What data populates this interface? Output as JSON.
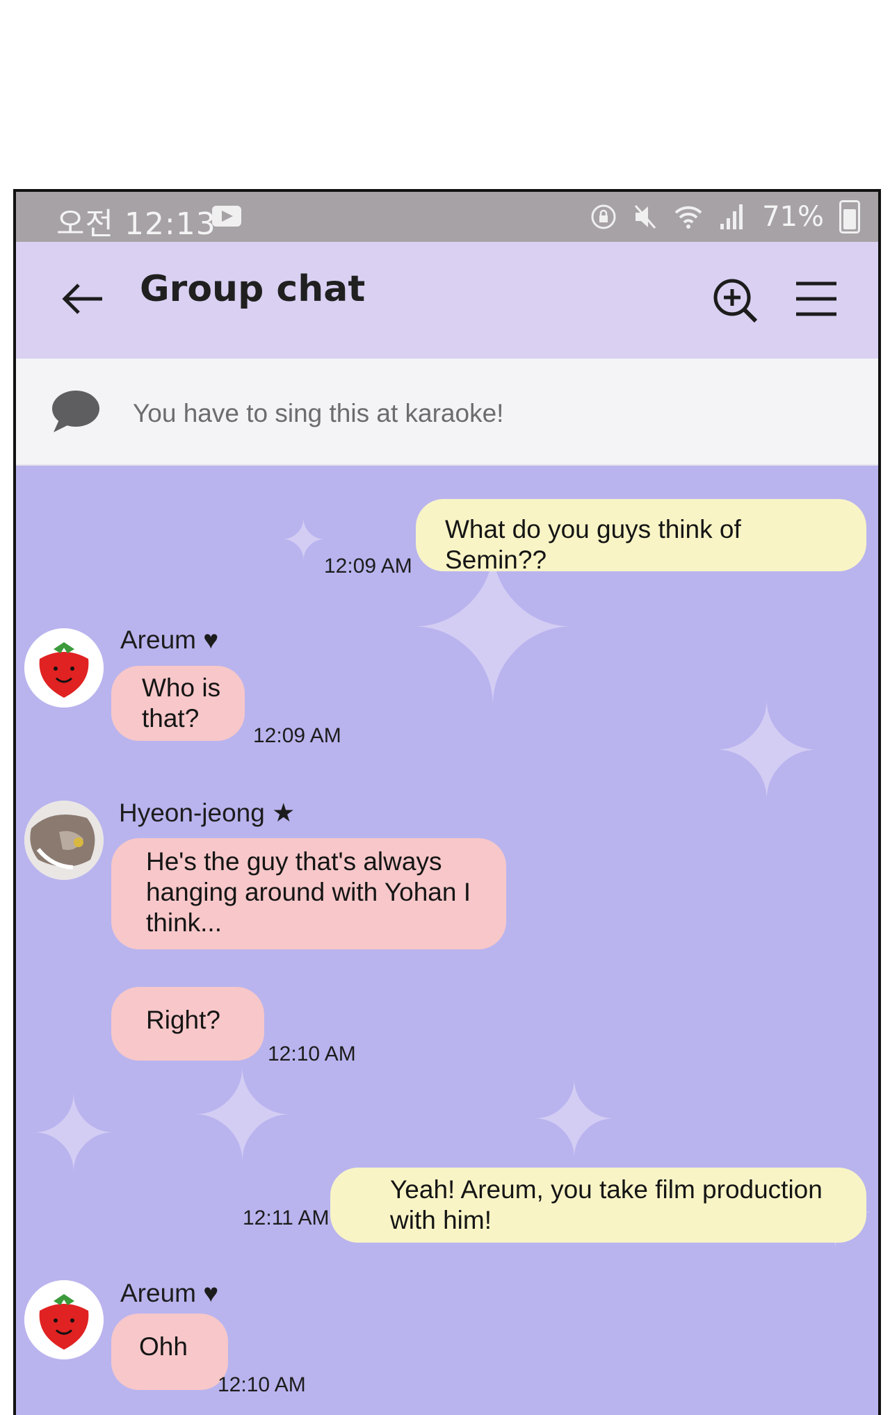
{
  "status_bar": {
    "time": "오전 12:13",
    "battery": "71%"
  },
  "header": {
    "title": "Group chat"
  },
  "notice": {
    "text": "You have to sing this at karaoke!"
  },
  "messages": [
    {
      "sender": "",
      "text": "What do you guys think of Semin??",
      "time": "12:09 AM"
    },
    {
      "sender": "Areum ♥",
      "text": "Who is that?",
      "time": "12:09 AM"
    },
    {
      "sender": "Hyeon-jeong ★",
      "text": "He's the guy that's always hanging around with Yohan I think...",
      "time": ""
    },
    {
      "sender": "",
      "text": "Right?",
      "time": "12:10 AM"
    },
    {
      "sender": "",
      "text": "Yeah! Areum, you take film production with him!",
      "time": "12:11 AM"
    },
    {
      "sender": "Areum ♥",
      "text": "Ohh",
      "time": "12:10 AM"
    }
  ],
  "colors": {
    "background": "#b9b4ee",
    "header": "#d9d0f2",
    "my_bubble": "#f8f4c6",
    "their_bubble": "#f7c7c9",
    "status_bar": "#a7a2a6"
  },
  "icons": [
    "back-arrow-icon",
    "search-plus-icon",
    "menu-icon",
    "speech-bubble-icon",
    "play-icon",
    "wifi-icon",
    "mute-icon",
    "battery-icon"
  ]
}
